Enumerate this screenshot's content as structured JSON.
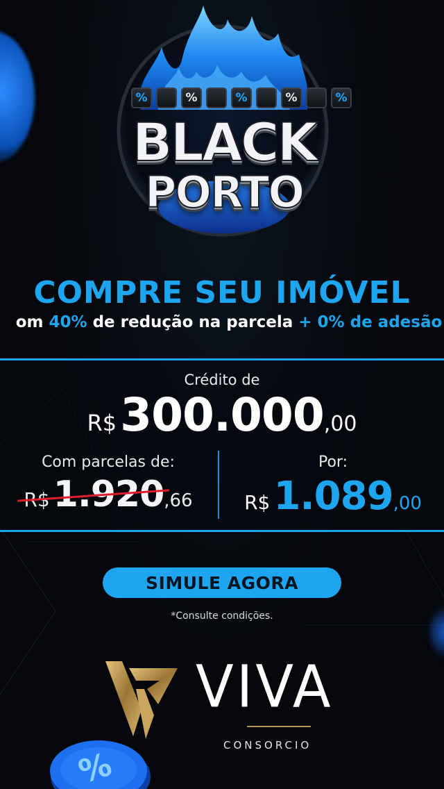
{
  "badge": {
    "line1": "BLACK",
    "line2": "PORTO",
    "percent_symbol": "%"
  },
  "headline": {
    "title": "COMPRE SEU IMÓVEL",
    "sub_prefix": "om ",
    "sub_highlight1": "40%",
    "sub_middle": " de redução na parcela ",
    "sub_highlight2": "+ 0% de adesão"
  },
  "offer": {
    "credit_label": "Crédito de",
    "credit_currency": "R$",
    "credit_amount": "300.000",
    "credit_cents": ",00",
    "old_label": "Com parcelas de:",
    "old_currency": "R$",
    "old_amount": "1.920",
    "old_cents": ",66",
    "new_label": "Por:",
    "new_currency": "R$",
    "new_amount": "1.089",
    "new_cents": ",00"
  },
  "cta": {
    "label": "SIMULE AGORA"
  },
  "disclaimer": "*Consulte condições.",
  "brand": {
    "name": "VIVA",
    "sub": "CONSORCIO"
  },
  "colors": {
    "accent": "#1ea5f0",
    "background": "#05070b",
    "strike": "#e11d2a",
    "gold": "#b8954e"
  }
}
